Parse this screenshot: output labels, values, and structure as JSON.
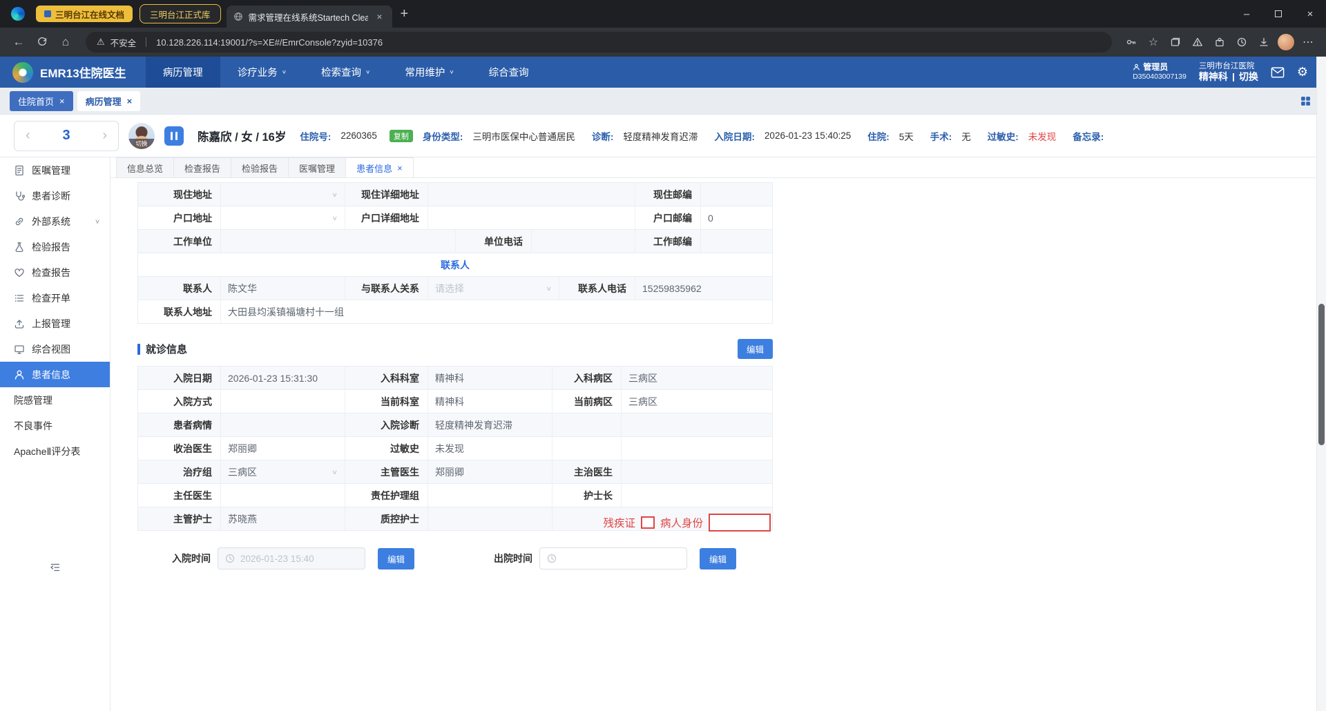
{
  "colors": {
    "header-blue": "#2b5ca8",
    "nav-active": "#1e4c96",
    "accent": "#2a6ae0",
    "label-blue": "#2b5fad",
    "sidebar-active": "#3e7ee0",
    "btn-blue": "#3d7fe0",
    "red": "#e04545",
    "green": "#4db052",
    "yellow": "#edbe3c"
  },
  "browser": {
    "tab_group_label": "三明台江在线文档",
    "grouped_tab_label": "三明台江正式库",
    "active_tab_label": "需求管理在线系统Startech ClearQ",
    "security_label": "不安全",
    "url": "10.128.226.114:19001/?s=XE#/EmrConsole?zyid=10376",
    "toolbar_icons": [
      "key-icon",
      "favorites-star-icon",
      "collections-icon",
      "alert-triangle-icon",
      "extensions-icon",
      "history-icon",
      "downloads-icon",
      "profile-avatar",
      "menu-dots-icon"
    ]
  },
  "header": {
    "app_title": "EMR13住院医生",
    "nav": [
      {
        "label": "病历管理"
      },
      {
        "label": "诊疗业务"
      },
      {
        "label": "检索查询"
      },
      {
        "label": "常用维护"
      },
      {
        "label": "综合查询"
      }
    ],
    "user_role": "管理员",
    "user_id": "D350403007139",
    "hospital": "三明市台江医院",
    "department": "精神科",
    "switch_label": "切换"
  },
  "page_tabs": [
    {
      "label": "住院首页"
    },
    {
      "label": "病历管理"
    }
  ],
  "patient": {
    "pager_value": "3",
    "avatar_switch_label": "切换",
    "name_line": "陈嘉欣 / 女 / 16岁",
    "admission_no_label": "住院号:",
    "admission_no": "2260365",
    "copy_label": "复制",
    "identity_label": "身份类型:",
    "identity": "三明市医保中心普通居民",
    "diagnosis_label": "诊断:",
    "diagnosis": "轻度精神发育迟滞",
    "admit_date_label": "入院日期:",
    "admit_date": "2026-01-23 15:40:25",
    "stay_label": "住院:",
    "stay": "5天",
    "surgery_label": "手术:",
    "surgery": "无",
    "allergy_label": "过敏史:",
    "allergy": "未发现",
    "memo_label": "备忘录:"
  },
  "sidebar": {
    "items": [
      {
        "label": "医嘱管理",
        "icon": "orders-icon"
      },
      {
        "label": "患者诊断",
        "icon": "diagnosis-icon"
      },
      {
        "label": "外部系统",
        "icon": "external-link-icon"
      },
      {
        "label": "检验报告",
        "icon": "lab-flask-icon"
      },
      {
        "label": "检查报告",
        "icon": "exam-heart-icon"
      },
      {
        "label": "检查开单",
        "icon": "exam-order-list-icon"
      },
      {
        "label": "上报管理",
        "icon": "upload-icon"
      },
      {
        "label": "综合视图",
        "icon": "monitor-icon"
      },
      {
        "label": "患者信息",
        "icon": "user-icon"
      },
      {
        "label": "院感管理",
        "icon": ""
      },
      {
        "label": "不良事件",
        "icon": ""
      },
      {
        "label": "ApacheⅡ评分表",
        "icon": ""
      }
    ]
  },
  "content": {
    "tabs": [
      {
        "label": "信息总览"
      },
      {
        "label": "检查报告"
      },
      {
        "label": "检验报告"
      },
      {
        "label": "医嘱管理"
      },
      {
        "label": "患者信息"
      }
    ],
    "contact": {
      "rows": {
        "r0": {
          "l1": "现住地址",
          "v1": "",
          "l2": "现住详细地址",
          "v2": "",
          "l3": "现住邮编",
          "v3": ""
        },
        "r1": {
          "l1": "户口地址",
          "v1": "",
          "l2": "户口详细地址",
          "v2": "",
          "l3": "户口邮编",
          "v3": "0"
        },
        "r2": {
          "l1": "工作单位",
          "v1": "",
          "l2": "单位电话",
          "v2": "",
          "l3": "工作邮编",
          "v3": ""
        },
        "header": "联系人",
        "r4": {
          "l1": "联系人",
          "v1": "陈文华",
          "l2": "与联系人关系",
          "v2": "请选择",
          "l3": "联系人电话",
          "v3": "15259835962"
        },
        "r5": {
          "l1": "联系人地址",
          "v1": "大田县均溪镇福塘村十一组"
        }
      }
    },
    "visit": {
      "title": "就诊信息",
      "edit_label": "编辑",
      "rows": {
        "r0": {
          "l1": "入院日期",
          "v1": "2026-01-23 15:31:30",
          "l2": "入科科室",
          "v2": "精神科",
          "l3": "入科病区",
          "v3": "三病区"
        },
        "r1": {
          "l1": "入院方式",
          "v1": "",
          "l2": "当前科室",
          "v2": "精神科",
          "l3": "当前病区",
          "v3": "三病区"
        },
        "r2": {
          "l1": "患者病情",
          "v1": "",
          "l2": "入院诊断",
          "v2": "轻度精神发育迟滞",
          "l3": "",
          "v3": ""
        },
        "r3": {
          "l1": "收治医生",
          "v1": "郑丽卿",
          "l2": "过敏史",
          "v2": "未发现",
          "l3": "",
          "v3": ""
        },
        "r4": {
          "l1": "治疗组",
          "v1": "三病区",
          "l2": "主管医生",
          "v2": "郑丽卿",
          "l3": "主治医生",
          "v3": ""
        },
        "r5": {
          "l1": "主任医生",
          "v1": "",
          "l2": "责任护理组",
          "v2": "",
          "l3": "护士长",
          "v3": ""
        },
        "r6": {
          "l1": "主管护士",
          "v1": "苏晓燕",
          "l2": "质控护士",
          "v2": ""
        }
      },
      "disability_label": "残疾证",
      "identity_label": "病人身份"
    },
    "footer": {
      "admit_label": "入院时间",
      "admit_value": "2026-01-23 15:40",
      "edit_label": "编辑",
      "discharge_label": "出院时间"
    }
  }
}
